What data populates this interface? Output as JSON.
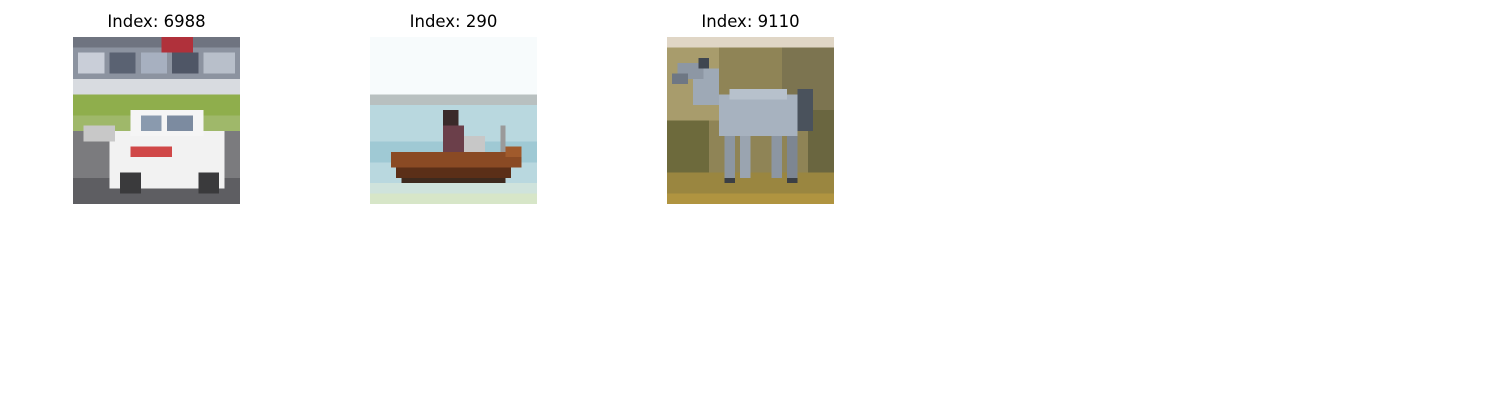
{
  "panels": [
    {
      "title": "Index: 6988",
      "image": "car-photo"
    },
    {
      "title": "Index: 290",
      "image": "boat-photo"
    },
    {
      "title": "Index: 9110",
      "image": "horse-photo"
    }
  ]
}
